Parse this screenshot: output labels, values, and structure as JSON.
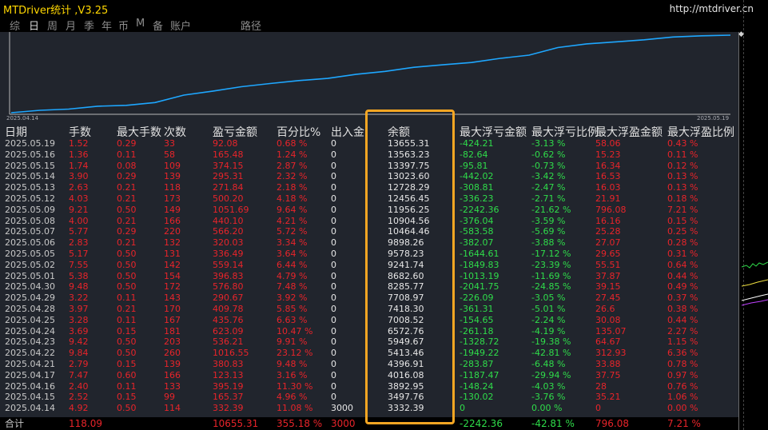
{
  "window": {
    "title": "MTDriver统计 ,V3.25",
    "url": "http://mtdriver.cn"
  },
  "tabs": [
    {
      "label": "综",
      "active": false
    },
    {
      "label": "日",
      "active": true
    },
    {
      "label": "周",
      "active": false
    },
    {
      "label": "月",
      "active": false
    },
    {
      "label": "季",
      "active": false
    },
    {
      "label": "年",
      "active": false
    },
    {
      "label": "币",
      "active": false
    },
    {
      "label": "M",
      "active": false
    },
    {
      "label": "备",
      "active": false
    },
    {
      "label": "账户",
      "active": false
    },
    {
      "label": "路径",
      "active": false
    }
  ],
  "chart": {
    "start_date": "2025.04.14",
    "end_date": "2025.05.19"
  },
  "columns": [
    "日期",
    "手数",
    "最大手数",
    "次数",
    "盈亏金额",
    "百分比%",
    "出入金",
    "余额",
    "最大浮亏金额",
    "最大浮亏比例",
    "最大浮盈金额",
    "最大浮盈比例"
  ],
  "rows": [
    {
      "date": "2025.05.19",
      "lots": "1.52",
      "maxlot": "0.29",
      "count": "33",
      "pnl": "92.08",
      "pct": "0.68 %",
      "io": "0",
      "bal": "13655.31",
      "mfl": "-424.21",
      "mflp": "-3.13 %",
      "mfp": "58.06",
      "mfpp": "0.43 %"
    },
    {
      "date": "2025.05.16",
      "lots": "1.36",
      "maxlot": "0.11",
      "count": "58",
      "pnl": "165.48",
      "pct": "1.24 %",
      "io": "0",
      "bal": "13563.23",
      "mfl": "-82.64",
      "mflp": "-0.62 %",
      "mfp": "15.23",
      "mfpp": "0.11 %"
    },
    {
      "date": "2025.05.15",
      "lots": "1.74",
      "maxlot": "0.08",
      "count": "109",
      "pnl": "374.15",
      "pct": "2.87 %",
      "io": "0",
      "bal": "13397.75",
      "mfl": "-95.81",
      "mflp": "-0.73 %",
      "mfp": "16.34",
      "mfpp": "0.12 %"
    },
    {
      "date": "2025.05.14",
      "lots": "3.90",
      "maxlot": "0.29",
      "count": "139",
      "pnl": "295.31",
      "pct": "2.32 %",
      "io": "0",
      "bal": "13023.60",
      "mfl": "-442.02",
      "mflp": "-3.42 %",
      "mfp": "16.53",
      "mfpp": "0.13 %"
    },
    {
      "date": "2025.05.13",
      "lots": "2.63",
      "maxlot": "0.21",
      "count": "118",
      "pnl": "271.84",
      "pct": "2.18 %",
      "io": "0",
      "bal": "12728.29",
      "mfl": "-308.81",
      "mflp": "-2.47 %",
      "mfp": "16.03",
      "mfpp": "0.13 %"
    },
    {
      "date": "2025.05.12",
      "lots": "4.03",
      "maxlot": "0.21",
      "count": "173",
      "pnl": "500.20",
      "pct": "4.18 %",
      "io": "0",
      "bal": "12456.45",
      "mfl": "-336.23",
      "mflp": "-2.71 %",
      "mfp": "21.91",
      "mfpp": "0.18 %"
    },
    {
      "date": "2025.05.09",
      "lots": "9.21",
      "maxlot": "0.50",
      "count": "149",
      "pnl": "1051.69",
      "pct": "9.64 %",
      "io": "0",
      "bal": "11956.25",
      "mfl": "-2242.36",
      "mflp": "-21.62 %",
      "mfp": "796.08",
      "mfpp": "7.21 %"
    },
    {
      "date": "2025.05.08",
      "lots": "4.00",
      "maxlot": "0.21",
      "count": "166",
      "pnl": "440.10",
      "pct": "4.21 %",
      "io": "0",
      "bal": "10904.56",
      "mfl": "-376.04",
      "mflp": "-3.59 %",
      "mfp": "16.16",
      "mfpp": "0.15 %"
    },
    {
      "date": "2025.05.07",
      "lots": "5.77",
      "maxlot": "0.29",
      "count": "220",
      "pnl": "566.20",
      "pct": "5.72 %",
      "io": "0",
      "bal": "10464.46",
      "mfl": "-583.58",
      "mflp": "-5.69 %",
      "mfp": "25.28",
      "mfpp": "0.25 %"
    },
    {
      "date": "2025.05.06",
      "lots": "2.83",
      "maxlot": "0.21",
      "count": "132",
      "pnl": "320.03",
      "pct": "3.34 %",
      "io": "0",
      "bal": "9898.26",
      "mfl": "-382.07",
      "mflp": "-3.88 %",
      "mfp": "27.07",
      "mfpp": "0.28 %"
    },
    {
      "date": "2025.05.05",
      "lots": "5.17",
      "maxlot": "0.50",
      "count": "131",
      "pnl": "336.49",
      "pct": "3.64 %",
      "io": "0",
      "bal": "9578.23",
      "mfl": "-1644.61",
      "mflp": "-17.12 %",
      "mfp": "29.65",
      "mfpp": "0.31 %"
    },
    {
      "date": "2025.05.02",
      "lots": "7.55",
      "maxlot": "0.50",
      "count": "142",
      "pnl": "559.14",
      "pct": "6.44 %",
      "io": "0",
      "bal": "9241.74",
      "mfl": "-1849.83",
      "mflp": "-23.39 %",
      "mfp": "55.51",
      "mfpp": "0.64 %"
    },
    {
      "date": "2025.05.01",
      "lots": "5.38",
      "maxlot": "0.50",
      "count": "154",
      "pnl": "396.83",
      "pct": "4.79 %",
      "io": "0",
      "bal": "8682.60",
      "mfl": "-1013.19",
      "mflp": "-11.69 %",
      "mfp": "37.87",
      "mfpp": "0.44 %"
    },
    {
      "date": "2025.04.30",
      "lots": "9.48",
      "maxlot": "0.50",
      "count": "172",
      "pnl": "576.80",
      "pct": "7.48 %",
      "io": "0",
      "bal": "8285.77",
      "mfl": "-2041.75",
      "mflp": "-24.85 %",
      "mfp": "39.15",
      "mfpp": "0.49 %"
    },
    {
      "date": "2025.04.29",
      "lots": "3.22",
      "maxlot": "0.11",
      "count": "143",
      "pnl": "290.67",
      "pct": "3.92 %",
      "io": "0",
      "bal": "7708.97",
      "mfl": "-226.09",
      "mflp": "-3.05 %",
      "mfp": "27.45",
      "mfpp": "0.37 %"
    },
    {
      "date": "2025.04.28",
      "lots": "3.97",
      "maxlot": "0.21",
      "count": "170",
      "pnl": "409.78",
      "pct": "5.85 %",
      "io": "0",
      "bal": "7418.30",
      "mfl": "-361.31",
      "mflp": "-5.01 %",
      "mfp": "26.6",
      "mfpp": "0.38 %"
    },
    {
      "date": "2025.04.25",
      "lots": "3.28",
      "maxlot": "0.11",
      "count": "167",
      "pnl": "435.76",
      "pct": "6.63 %",
      "io": "0",
      "bal": "7008.52",
      "mfl": "-154.65",
      "mflp": "-2.24 %",
      "mfp": "30.08",
      "mfpp": "0.44 %"
    },
    {
      "date": "2025.04.24",
      "lots": "3.69",
      "maxlot": "0.15",
      "count": "181",
      "pnl": "623.09",
      "pct": "10.47 %",
      "io": "0",
      "bal": "6572.76",
      "mfl": "-261.18",
      "mflp": "-4.19 %",
      "mfp": "135.07",
      "mfpp": "2.27 %"
    },
    {
      "date": "2025.04.23",
      "lots": "9.42",
      "maxlot": "0.50",
      "count": "203",
      "pnl": "536.21",
      "pct": "9.91 %",
      "io": "0",
      "bal": "5949.67",
      "mfl": "-1328.72",
      "mflp": "-19.38 %",
      "mfp": "64.67",
      "mfpp": "1.15 %"
    },
    {
      "date": "2025.04.22",
      "lots": "9.84",
      "maxlot": "0.50",
      "count": "260",
      "pnl": "1016.55",
      "pct": "23.12 %",
      "io": "0",
      "bal": "5413.46",
      "mfl": "-1949.22",
      "mflp": "-42.81 %",
      "mfp": "312.93",
      "mfpp": "6.36 %"
    },
    {
      "date": "2025.04.21",
      "lots": "2.79",
      "maxlot": "0.15",
      "count": "139",
      "pnl": "380.83",
      "pct": "9.48 %",
      "io": "0",
      "bal": "4396.91",
      "mfl": "-283.87",
      "mflp": "-6.48 %",
      "mfp": "33.88",
      "mfpp": "0.78 %"
    },
    {
      "date": "2025.04.17",
      "lots": "7.47",
      "maxlot": "0.60",
      "count": "166",
      "pnl": "123.13",
      "pct": "3.16 %",
      "io": "0",
      "bal": "4016.08",
      "mfl": "-1187.47",
      "mflp": "-29.94 %",
      "mfp": "37.75",
      "mfpp": "0.97 %"
    },
    {
      "date": "2025.04.16",
      "lots": "2.40",
      "maxlot": "0.11",
      "count": "133",
      "pnl": "395.19",
      "pct": "11.30 %",
      "io": "0",
      "bal": "3892.95",
      "mfl": "-148.24",
      "mflp": "-4.03 %",
      "mfp": "28",
      "mfpp": "0.76 %"
    },
    {
      "date": "2025.04.15",
      "lots": "2.52",
      "maxlot": "0.15",
      "count": "99",
      "pnl": "165.37",
      "pct": "4.96 %",
      "io": "0",
      "bal": "3497.76",
      "mfl": "-130.02",
      "mflp": "-3.76 %",
      "mfp": "35.21",
      "mfpp": "1.06 %"
    },
    {
      "date": "2025.04.14",
      "lots": "4.92",
      "maxlot": "0.50",
      "count": "114",
      "pnl": "332.39",
      "pct": "11.08 %",
      "io": "3000",
      "bal": "3332.39",
      "mfl": "0",
      "mflp": "0.00 %",
      "mfp": "0",
      "mfpp": "0.00 %"
    }
  ],
  "total": {
    "label": "合计",
    "lots": "118.09",
    "pnl": "10655.31",
    "pct": "355.18 %",
    "io": "3000",
    "mfl": "-2242.36",
    "mflp": "-42.81 %",
    "mfp": "796.08",
    "mfpp": "7.21 %"
  },
  "colors": {
    "title": "#ffd700",
    "loss_red": "#e8242a",
    "floating_green": "#2fdc4a",
    "balance_line": "#1ea7ff",
    "highlight_box": "#f5a623"
  }
}
